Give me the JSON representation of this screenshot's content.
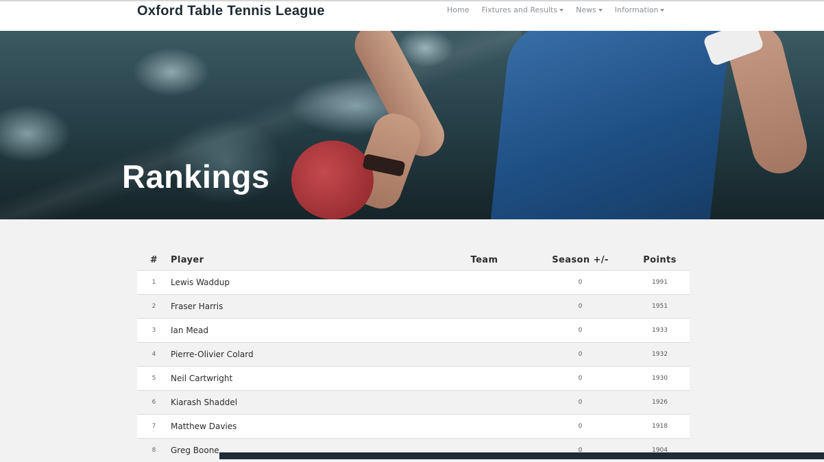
{
  "header": {
    "brand": "Oxford Table Tennis League",
    "nav": [
      {
        "label": "Home",
        "dropdown": false
      },
      {
        "label": "Fixtures and Results",
        "dropdown": true
      },
      {
        "label": "News",
        "dropdown": true
      },
      {
        "label": "Information",
        "dropdown": true
      }
    ]
  },
  "hero": {
    "title": "Rankings"
  },
  "table": {
    "columns": [
      "#",
      "Player",
      "Team",
      "Season +/-",
      "Points"
    ],
    "rows": [
      {
        "rank": "1",
        "player": "Lewis Waddup",
        "team": "",
        "season": "0",
        "points": "1991"
      },
      {
        "rank": "2",
        "player": "Fraser Harris",
        "team": "",
        "season": "0",
        "points": "1951"
      },
      {
        "rank": "3",
        "player": "Ian Mead",
        "team": "",
        "season": "0",
        "points": "1933"
      },
      {
        "rank": "4",
        "player": "Pierre-Olivier Colard",
        "team": "",
        "season": "0",
        "points": "1932"
      },
      {
        "rank": "5",
        "player": "Neil Cartwright",
        "team": "",
        "season": "0",
        "points": "1930"
      },
      {
        "rank": "6",
        "player": "Kiarash Shaddel",
        "team": "",
        "season": "0",
        "points": "1926"
      },
      {
        "rank": "7",
        "player": "Matthew Davies",
        "team": "",
        "season": "0",
        "points": "1918"
      },
      {
        "rank": "8",
        "player": "Greg Boone",
        "team": "",
        "season": "0",
        "points": "1904"
      }
    ]
  }
}
